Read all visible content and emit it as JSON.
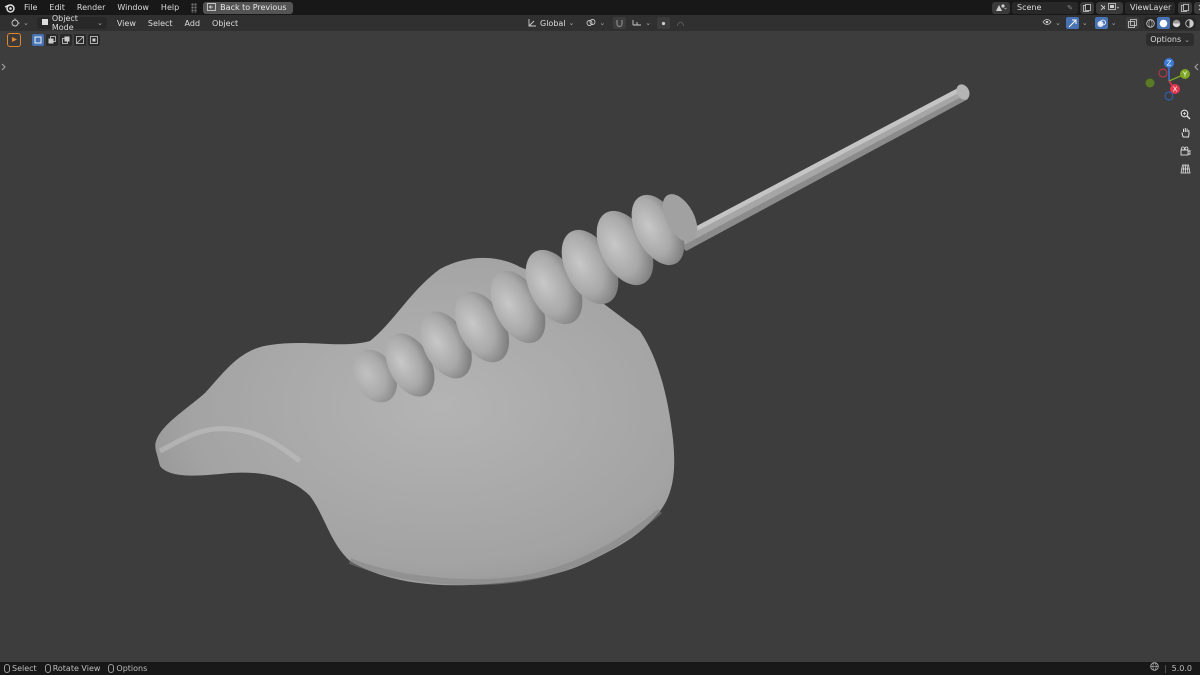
{
  "topbar": {
    "menu": [
      "File",
      "Edit",
      "Render",
      "Window",
      "Help"
    ],
    "back_label": "Back to Previous",
    "scene_label": "Scene",
    "view_layer_label": "ViewLayer"
  },
  "header": {
    "mode_label": "Object Mode",
    "menus": [
      "View",
      "Select",
      "Add",
      "Object"
    ],
    "orientation_label": "Global",
    "options_label": "Options"
  },
  "gizmo": {
    "axes": [
      "Z",
      "Y",
      "X"
    ]
  },
  "statusbar": {
    "items": [
      "Select",
      "Rotate View",
      "Options"
    ],
    "version": "5.0.0"
  },
  "colors": {
    "accent": "#4772b3",
    "active_tool": "#e1852b",
    "axis_x": "#e2374f",
    "axis_y": "#7ea623",
    "axis_z": "#3a7ad8",
    "mesh": "#a9a9a9"
  },
  "icons": [
    "blender-logo-icon",
    "back-arrow-icon",
    "scene-icon",
    "view-layer-icon",
    "editor-type-icon",
    "object-mode-icon",
    "transform-orientation-icon",
    "snap-icon",
    "proportional-edit-icon",
    "visibility-icon",
    "gizmo-icon",
    "overlay-icon",
    "xray-icon",
    "shading-wireframe-icon",
    "shading-solid-icon",
    "shading-material-icon",
    "shading-rendered-icon",
    "zoom-icon",
    "pan-hand-icon",
    "camera-icon",
    "perspective-grid-icon"
  ]
}
